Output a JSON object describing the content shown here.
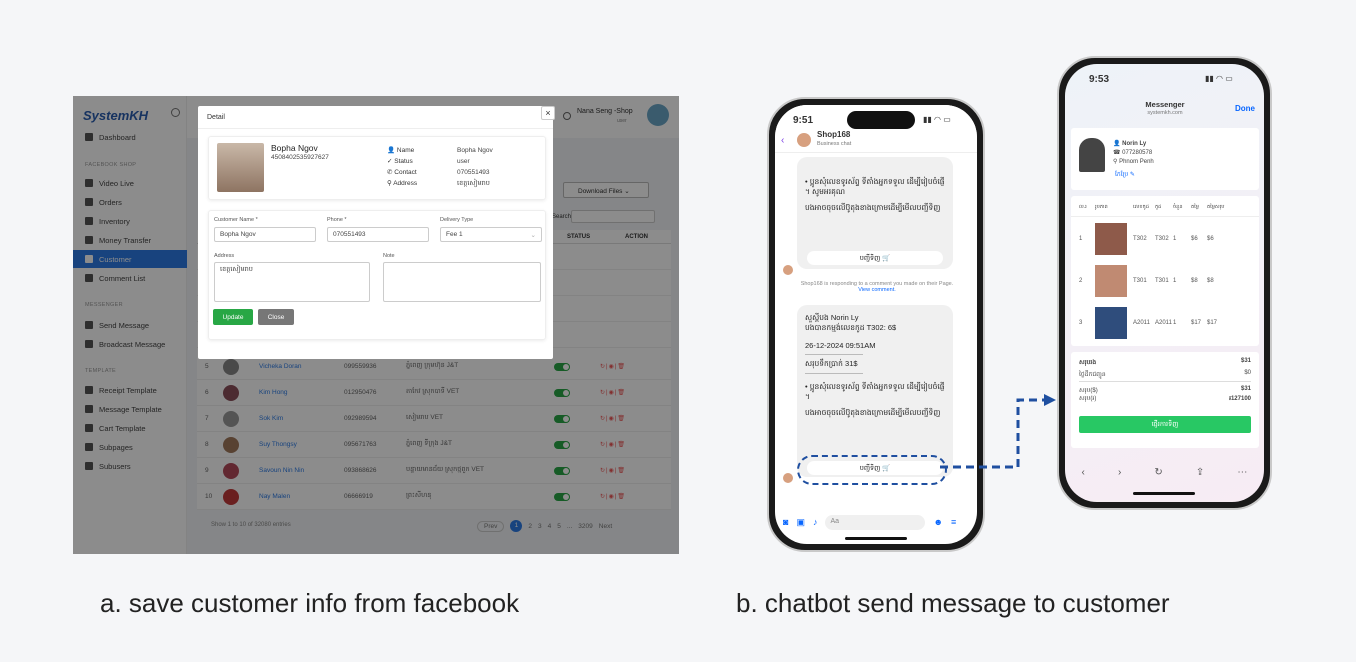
{
  "panel_a": {
    "logo": "SystemKH",
    "sidebar": {
      "dashboard": "Dashboard",
      "section_shop": "FACEBOOK SHOP",
      "items_shop": [
        "Video Live",
        "Orders",
        "Inventory",
        "Money Transfer",
        "Customer",
        "Comment List"
      ],
      "section_messenger": "MESSENGER",
      "items_messenger": [
        "Send Message",
        "Broadcast Message"
      ],
      "section_template": "TEMPLATE",
      "items_template": [
        "Receipt Template",
        "Message Template",
        "Cart Template",
        "Subpages",
        "Subusers"
      ]
    },
    "topbar": {
      "user": "Nana Seng -Shop",
      "role": "user"
    },
    "download_button": "Download Files",
    "search_label": "Search:",
    "table": {
      "col_status": "STATUS",
      "col_action": "ACTION",
      "rows": [
        {
          "n": "5",
          "name": "Vicheka Doran",
          "phone": "099559936",
          "addr": "ភ្នំពេញ ក្រុមហ៊ុន J&T"
        },
        {
          "n": "6",
          "name": "Kim Hong",
          "phone": "012950476",
          "addr": "តាកែវ ស្រុកបាទី VET"
        },
        {
          "n": "7",
          "name": "Sok Kim",
          "phone": "092989594",
          "addr": "សៀមរាប VET"
        },
        {
          "n": "8",
          "name": "Suy Thongsy",
          "phone": "095671763",
          "addr": "ភ្នំពេញ ទីក្រុង J&T"
        },
        {
          "n": "9",
          "name": "Savoun Nin Nin",
          "phone": "093868626",
          "addr": "បន្ទាយមានជ័យ ស្រុកថ្មពួក VET"
        },
        {
          "n": "10",
          "name": "Nay Malen",
          "phone": "06666919",
          "addr": "ព្រះសីហនុ"
        }
      ],
      "footer": "Show 1 to 10 of 32080 entries",
      "pagination": [
        "Prev",
        "1",
        "2",
        "3",
        "4",
        "5",
        "...",
        "3209",
        "Next"
      ]
    },
    "modal": {
      "title": "Detail",
      "close": "×",
      "name": "Bopha Ngov",
      "fb_id": "4508402535927627",
      "info_labels": [
        "Name",
        "Status",
        "Contact",
        "Address"
      ],
      "info_values": [
        "Bopha Ngov",
        "user",
        "070551493",
        "ខេត្តសៀមរាប"
      ],
      "form": {
        "customer_name_label": "Customer Name *",
        "customer_name_value": "Bopha Ngov",
        "phone_label": "Phone *",
        "phone_value": "070551493",
        "delivery_label": "Delivery Type",
        "delivery_value": "Fee 1",
        "address_label": "Address",
        "address_value": "ខេត្តសៀមរាប",
        "note_label": "Note",
        "update": "Update",
        "close": "Close"
      }
    }
  },
  "phone1": {
    "time": "9:51",
    "shop": "Shop168",
    "subtitle": "Business chat",
    "bubble1_text": "• ប្អូនសុំលេខទូរស័ព្ទ ទីតាំងអ្នកទទួល ដើម្បីរៀបចំផ្ញើ ។ សូមអរគុណ",
    "bubble1_line2": "បងអាចចុចលើប៊ូតុងខាងក្រោមដើម្បីមើលបញ្ជីទិញ",
    "quick1": "បញ្ជីទិញ 🛒",
    "notice": "Shop168 is responding to a comment you made on their Page.",
    "view_comment": "View comment.",
    "b2_name": "សួស្តីបង Norin Ly",
    "b2_order": "បងបានកម្មង់លេខកូដ T302: 6$",
    "b2_date": "26-12-2024 09:51AM",
    "dash": "-----------------------------",
    "b2_total": "សរុបទឹកប្រាក់ 31$",
    "b2_text": "• ប្អូនសុំលេខទូរស័ព្ទ ទីតាំងអ្នកទទួល ដើម្បីរៀបចំផ្ញើ ។",
    "b2_line2": "បងអាចចុចលើប៊ូតុងខាងក្រោមដើម្បីមើលបញ្ជីទិញ",
    "quick2": "បញ្ជីទិញ 🛒",
    "input_placeholder": "Aa"
  },
  "phone2": {
    "time": "9:53",
    "header_title": "Messenger",
    "header_url": "systemkh.com",
    "done": "Done",
    "customer": "Norin Ly",
    "phone": "077280578",
    "location": "Phnom Penh",
    "edit": "កែប្រែ",
    "table_headers": [
      "ល.រ",
      "រូបភាព",
      "លេខកូដ",
      "កូដ",
      "ចំនួន",
      "តម្លៃ",
      "តម្លៃសរុប"
    ],
    "rows": [
      {
        "n": "1",
        "code": "T302",
        "code2": "T302",
        "qty": "1",
        "price": "$6",
        "total": "$6"
      },
      {
        "n": "2",
        "code": "T301",
        "code2": "T301",
        "qty": "1",
        "price": "$8",
        "total": "$8"
      },
      {
        "n": "3",
        "code": "A2011",
        "code2": "A2011",
        "qty": "1",
        "price": "$17",
        "total": "$17"
      }
    ],
    "subtotal_label": "សរុបរង",
    "subtotal": "$31",
    "shipping_label": "ថ្លៃដឹកជញ្ជូន",
    "shipping": "$0",
    "total_usd_label": "សរុប($)",
    "total_usd": "$31",
    "total_khr_label": "សរុប(៛)",
    "total_khr": "៛127100",
    "confirm": "ផ្ញើរការទិញ"
  },
  "captions": {
    "a": "a. save customer info from facebook",
    "b": "b. chatbot send message to customer"
  },
  "colors": {
    "primary": "#2d7be5",
    "green": "#28a745",
    "messenger": "#0866ff"
  }
}
